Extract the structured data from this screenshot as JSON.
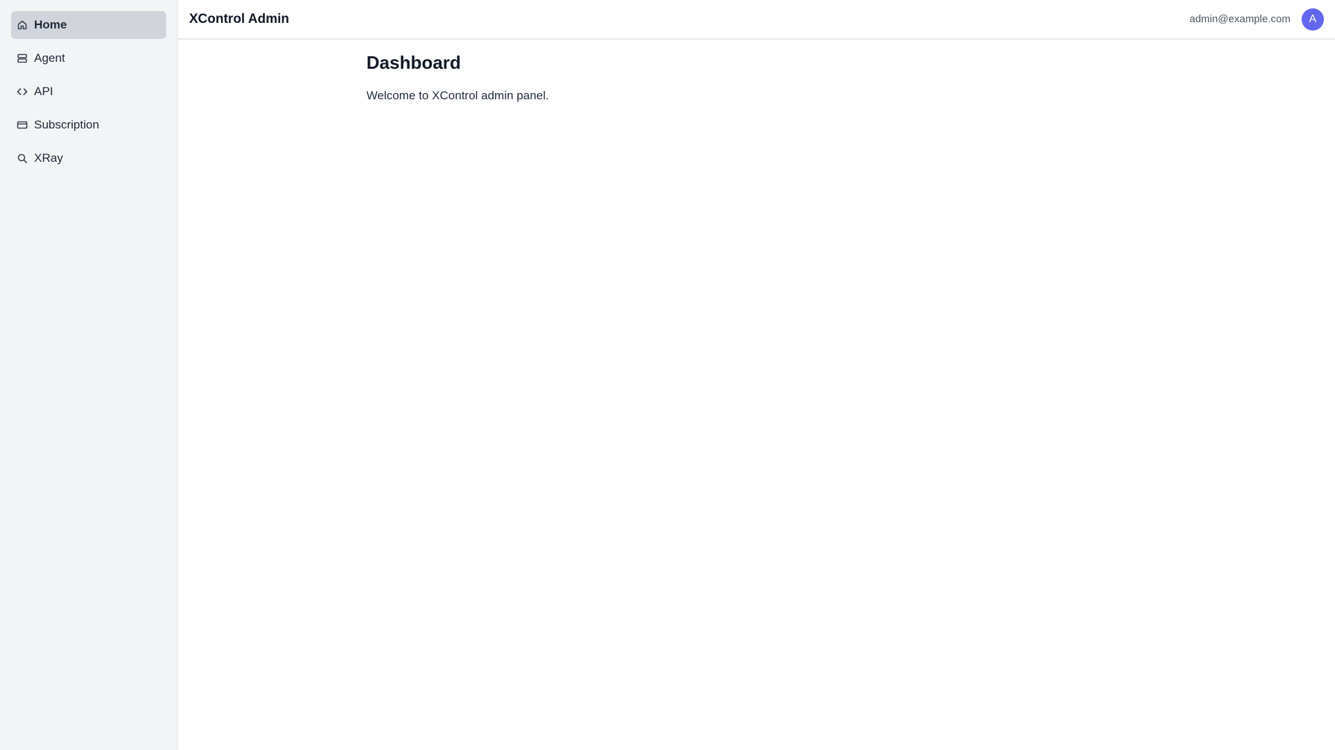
{
  "header": {
    "title": "XControl Admin",
    "user_email": "admin@example.com",
    "avatar_initial": "A"
  },
  "sidebar": {
    "items": [
      {
        "label": "Home",
        "icon": "home-icon",
        "active": true
      },
      {
        "label": "Agent",
        "icon": "server-icon",
        "active": false
      },
      {
        "label": "API",
        "icon": "code-icon",
        "active": false
      },
      {
        "label": "Subscription",
        "icon": "credit-card-icon",
        "active": false
      },
      {
        "label": "XRay",
        "icon": "search-icon",
        "active": false
      }
    ]
  },
  "main": {
    "title": "Dashboard",
    "subtitle": "Welcome to XControl admin panel."
  },
  "colors": {
    "sidebar_bg": "#f3f4f6",
    "active_item_bg": "#d1d5db",
    "avatar_bg": "#6366f1"
  }
}
